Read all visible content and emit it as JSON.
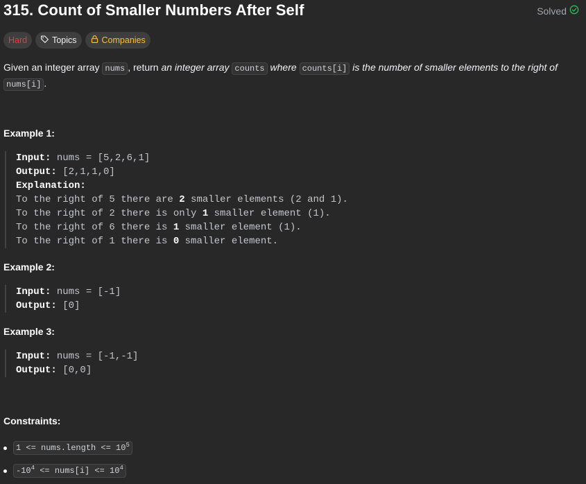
{
  "header": {
    "title": "315. Count of Smaller Numbers After Self",
    "solved_label": "Solved"
  },
  "tags": {
    "difficulty": "Hard",
    "topics": "Topics",
    "companies": "Companies"
  },
  "description": {
    "part1": "Given an integer array ",
    "code1": "nums",
    "part2": ", return ",
    "em1": "an integer array ",
    "code2": "counts",
    "em2": " where ",
    "code3": "counts[i]",
    "em3": " is the number of smaller elements to the right of ",
    "code4": "nums[i]",
    "part3": "."
  },
  "examples": [
    {
      "title": "Example 1:",
      "input_label": "Input:",
      "input_value": " nums = [5,2,6,1]",
      "output_label": "Output:",
      "output_value": " [2,1,1,0]",
      "explanation_label": "Explanation:",
      "lines": [
        {
          "pre": "To the right of 5 there are ",
          "bold": "2",
          "post": " smaller elements (2 and 1)."
        },
        {
          "pre": "To the right of 2 there is only ",
          "bold": "1",
          "post": " smaller element (1)."
        },
        {
          "pre": "To the right of 6 there is ",
          "bold": "1",
          "post": " smaller element (1)."
        },
        {
          "pre": "To the right of 1 there is ",
          "bold": "0",
          "post": " smaller element."
        }
      ]
    },
    {
      "title": "Example 2:",
      "input_label": "Input:",
      "input_value": " nums = [-1]",
      "output_label": "Output:",
      "output_value": " [0]"
    },
    {
      "title": "Example 3:",
      "input_label": "Input:",
      "input_value": " nums = [-1,-1]",
      "output_label": "Output:",
      "output_value": " [0,0]"
    }
  ],
  "constraints": {
    "title": "Constraints:",
    "c1_text": "1 <= nums.length <= 10",
    "c1_exp": "5",
    "c2_pre": "-10",
    "c2_exp1": "4",
    "c2_mid": " <= nums[i] <= 10",
    "c2_exp2": "4"
  },
  "colors": {
    "background": "#282828",
    "hard": "#f63737",
    "companies": "#ffc01e",
    "solved_check": "#2cbb5d"
  }
}
